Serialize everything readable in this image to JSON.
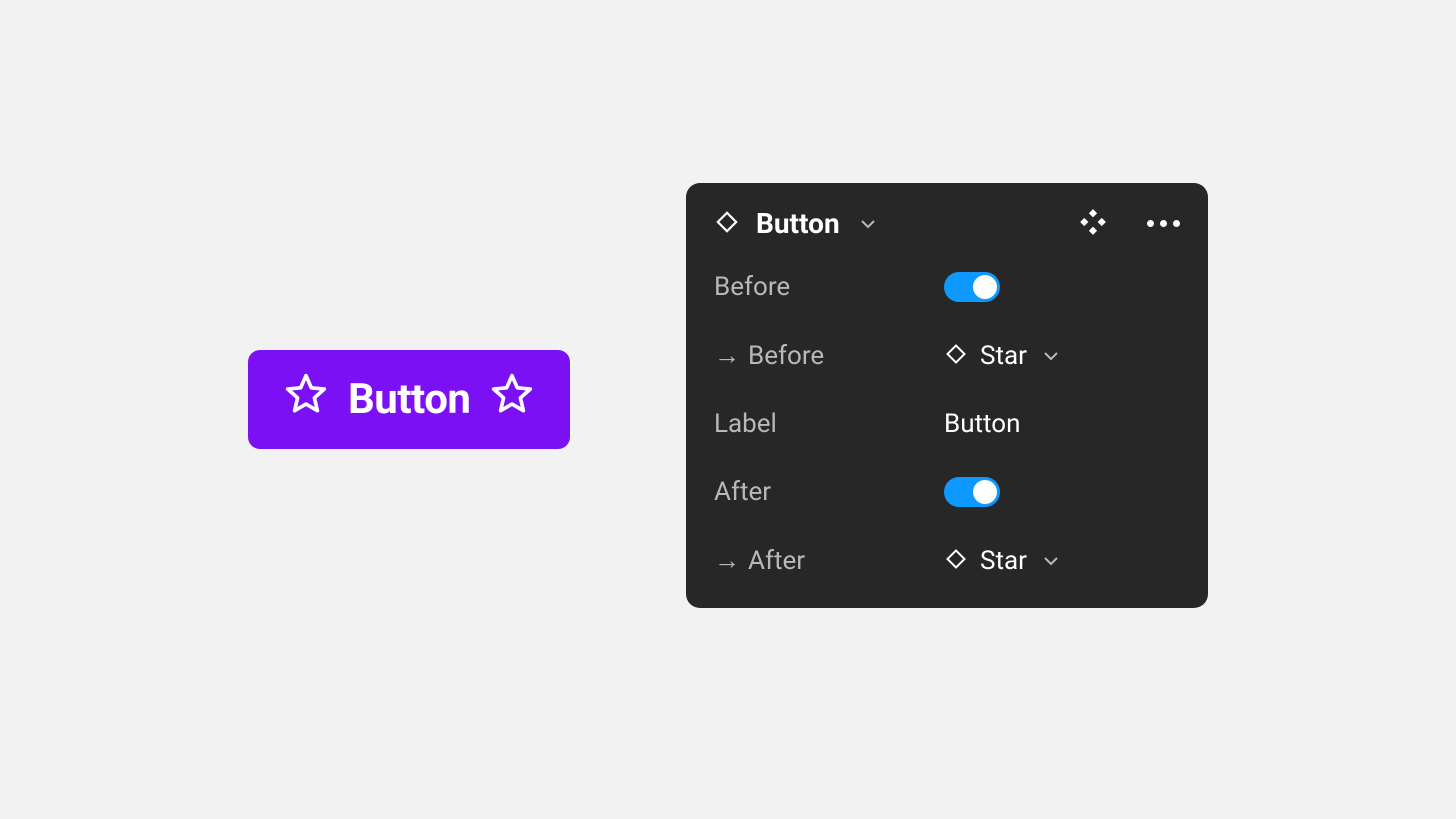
{
  "button_component": {
    "label": "Button",
    "before_icon": "star",
    "after_icon": "star",
    "bg_color": "#7B10F4"
  },
  "panel": {
    "header": {
      "title": "Button"
    },
    "rows": {
      "before": {
        "label": "Before",
        "toggle_on": true
      },
      "before_swap": {
        "label": "Before",
        "value": "Star"
      },
      "label": {
        "label": "Label",
        "value": "Button"
      },
      "after": {
        "label": "After",
        "toggle_on": true
      },
      "after_swap": {
        "label": "After",
        "value": "Star"
      }
    }
  }
}
